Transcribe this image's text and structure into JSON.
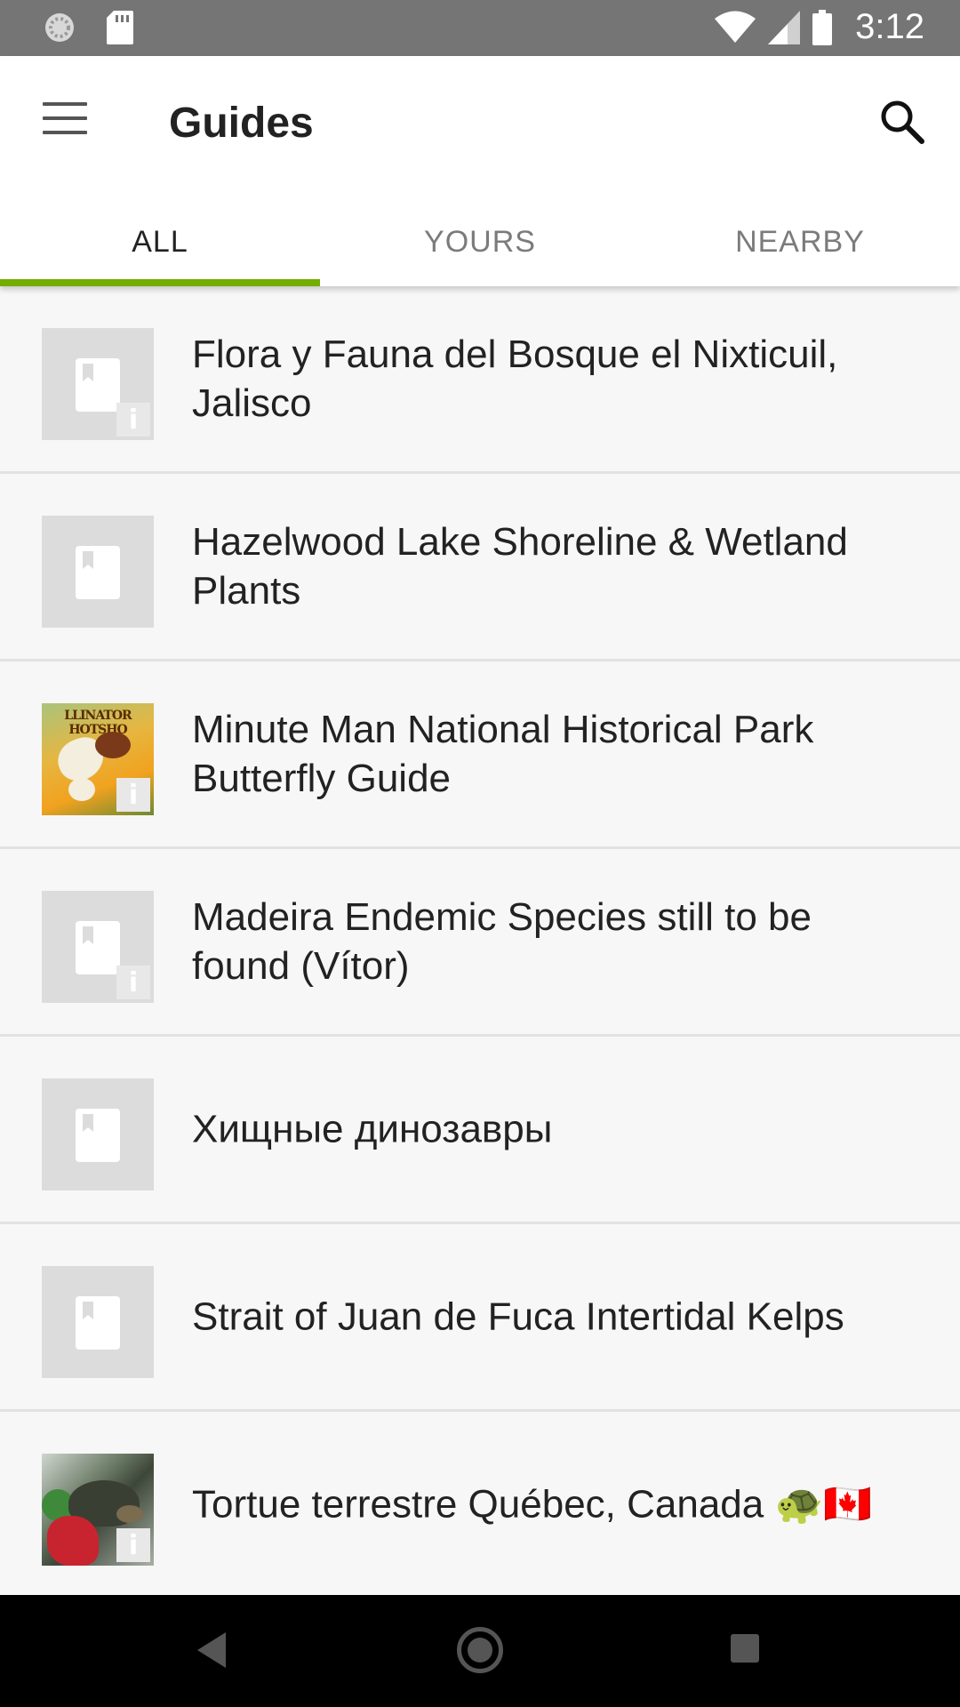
{
  "status_bar": {
    "time": "3:12",
    "icons": [
      "sync-circle-icon",
      "sd-card-icon",
      "wifi-icon",
      "signal-icon",
      "battery-icon"
    ]
  },
  "app_bar": {
    "title": "Guides",
    "menu_icon": "hamburger-menu-icon",
    "search_icon": "search-icon"
  },
  "tabs": [
    {
      "label": "ALL",
      "active": true
    },
    {
      "label": "YOURS",
      "active": false
    },
    {
      "label": "NEARBY",
      "active": false
    }
  ],
  "colors": {
    "accent": "#74ac00",
    "status_bar": "#757575",
    "background": "#f7f7f7"
  },
  "guides": [
    {
      "title": "Flora y Fauna del Bosque el Nixticuil, Jalisco",
      "thumbnail": "book-placeholder-icon",
      "info_badge": "i"
    },
    {
      "title": "Hazelwood Lake Shoreline & Wetland Plants",
      "thumbnail": "book-placeholder-icon",
      "info_badge": ""
    },
    {
      "title": "Minute Man National Historical Park Butterfly Guide",
      "thumbnail": "butterfly-photo",
      "photo_text": "LLINATOR HOTSHO",
      "info_badge": "i"
    },
    {
      "title": "Madeira Endemic Species still to be found (Vítor)",
      "thumbnail": "book-placeholder-icon",
      "info_badge": "i"
    },
    {
      "title": "Хищные динозавры",
      "thumbnail": "book-placeholder-icon",
      "info_badge": ""
    },
    {
      "title": "Strait of Juan de Fuca Intertidal Kelps",
      "thumbnail": "book-placeholder-icon",
      "info_badge": ""
    },
    {
      "title": "Tortue terrestre Québec, Canada 🐢🇨🇦",
      "thumbnail": "turtle-photo",
      "info_badge": "i"
    }
  ],
  "nav_bar": {
    "icons": [
      "back-icon",
      "home-icon",
      "recent-apps-icon"
    ]
  }
}
